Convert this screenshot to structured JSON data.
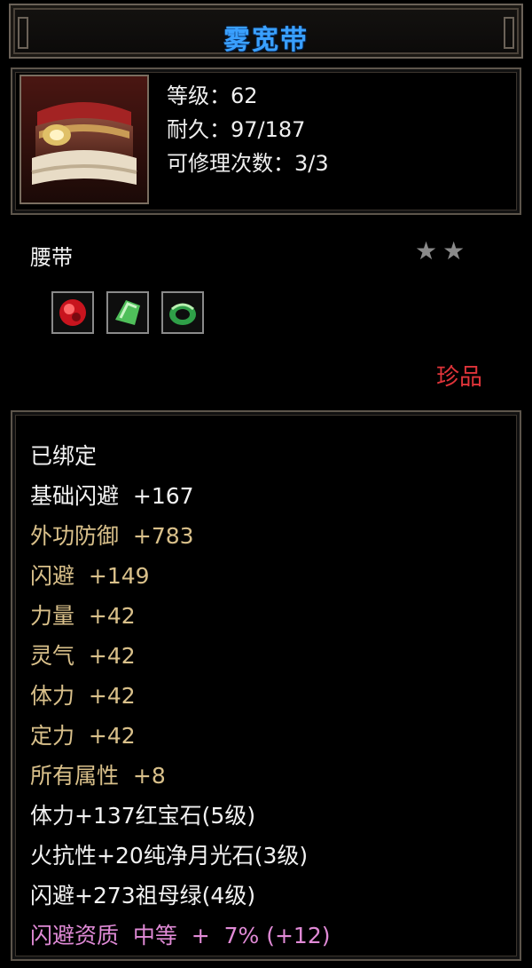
{
  "item": {
    "name": "雾宽带",
    "level_line": "等级：62",
    "durability_line": "耐久：97/187",
    "repair_line": "可修理次数：3/3",
    "type": "腰带",
    "stars": "★★",
    "rarity": "珍品",
    "icon": "belt-icon",
    "gems": [
      {
        "name": "ruby-gem-icon",
        "color": "#c8141e"
      },
      {
        "name": "moonstone-gem-icon",
        "color": "#4fbf5a"
      },
      {
        "name": "emerald-ring-icon",
        "color": "#2f9f48"
      }
    ]
  },
  "attributes": [
    {
      "text": "已绑定",
      "tone": "white"
    },
    {
      "text": "基础闪避  +167",
      "tone": "white"
    },
    {
      "text": "外功防御  +783",
      "tone": "gold"
    },
    {
      "text": "闪避  +149",
      "tone": "gold"
    },
    {
      "text": "力量  +42",
      "tone": "gold"
    },
    {
      "text": "灵气  +42",
      "tone": "gold"
    },
    {
      "text": "体力  +42",
      "tone": "gold"
    },
    {
      "text": "定力  +42",
      "tone": "gold"
    },
    {
      "text": "所有属性  +8",
      "tone": "gold"
    },
    {
      "text": "体力+137红宝石(5级)",
      "tone": "white"
    },
    {
      "text": "火抗性+20纯净月光石(3级)",
      "tone": "white"
    },
    {
      "text": "闪避+273祖母绿(4级)",
      "tone": "white"
    },
    {
      "text": "闪避资质  中等  +  7% (+12)",
      "tone": "pink"
    }
  ],
  "colors": {
    "title": "#3aa0ff",
    "rarity": "#e0343a",
    "gold_text": "#d9c08a",
    "pink_text": "#e08ad6"
  }
}
